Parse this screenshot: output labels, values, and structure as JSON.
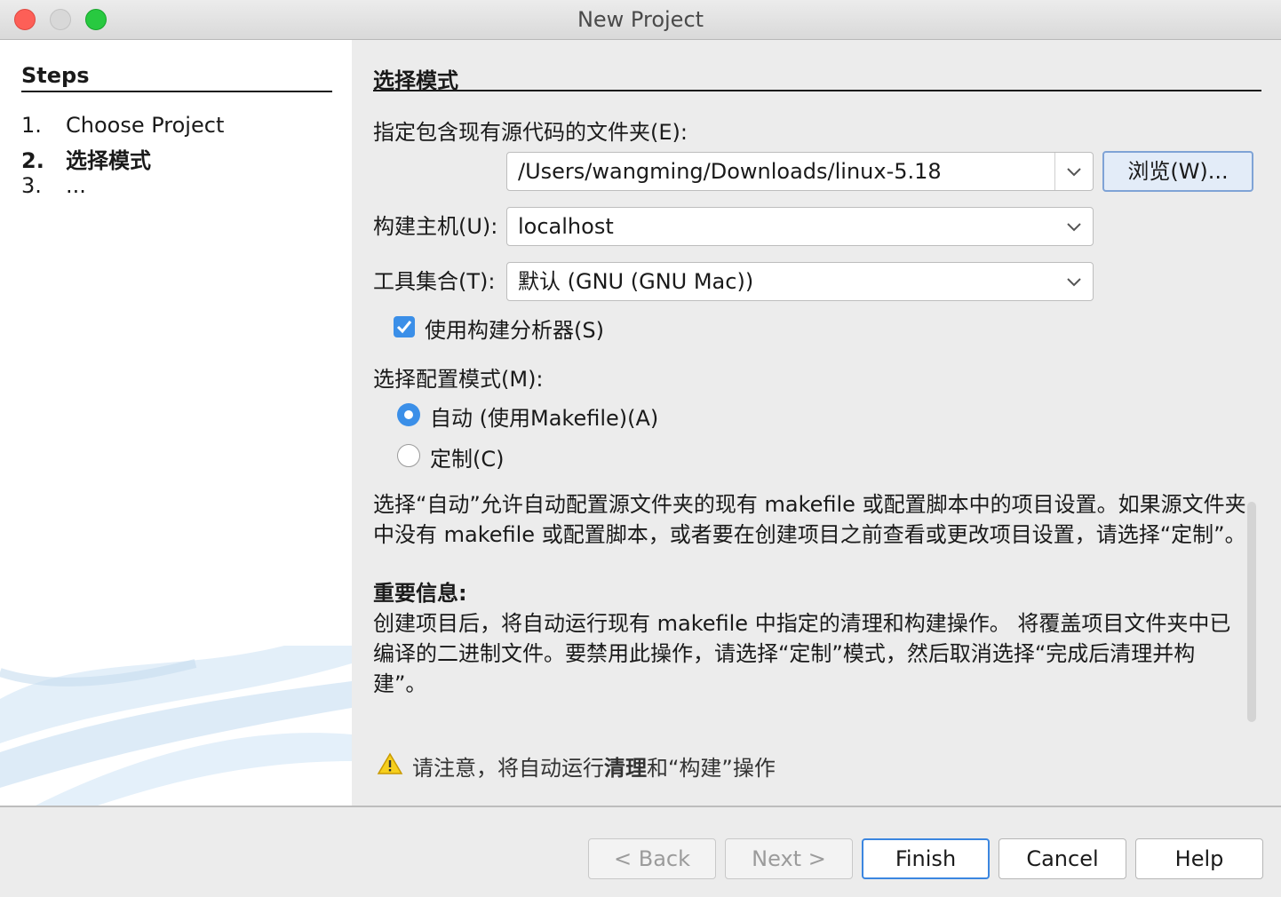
{
  "window": {
    "title": "New Project"
  },
  "sidebar": {
    "title": "Steps",
    "steps": [
      {
        "number": "1.",
        "label": "Choose Project"
      },
      {
        "number": "2.",
        "label": "选择模式",
        "current": true
      },
      {
        "number": "3.",
        "label": "..."
      }
    ]
  },
  "main": {
    "section_title": "选择模式",
    "folder_label": "指定包含现有源代码的文件夹(E):",
    "folder_value": "/Users/wangming/Downloads/linux-5.18",
    "browse_label": "浏览(W)...",
    "host_label": "构建主机(U):",
    "host_value": "localhost",
    "toolset_label": "工具集合(T):",
    "toolset_value": "默认 (GNU (GNU Mac))",
    "analyzer_checkbox": {
      "label": "使用构建分析器(S)",
      "checked": true
    },
    "config_mode_label": "选择配置模式(M):",
    "mode_options": [
      {
        "label": "自动 (使用Makefile)(A)",
        "selected": true
      },
      {
        "label": "定制(C)",
        "selected": false
      }
    ],
    "description": "选择“自动”允许自动配置源文件夹的现有 makefile 或配置脚本中的项目设置。如果源文件夹中没有 makefile 或配置脚本，或者要在创建项目之前查看或更改项目设置，请选择“定制”。",
    "important_heading": "重要信息:",
    "important_text": "创建项目后，将自动运行现有 makefile 中指定的清理和构建操作。 将覆盖项目文件夹中已编译的二进制文件。要禁用此操作，请选择“定制”模式，然后取消选择“完成后清理并构建”。",
    "warning": {
      "prefix": "请注意，将自动运行",
      "bold": "清理",
      "suffix": "和“构建”操作"
    }
  },
  "footer": {
    "back": "< Back",
    "next": "Next >",
    "finish": "Finish",
    "cancel": "Cancel",
    "help": "Help"
  },
  "colors": {
    "accent": "#3b8fe8",
    "close": "#fd5f57",
    "zoom": "#28c940",
    "warning": "#f3c300"
  }
}
